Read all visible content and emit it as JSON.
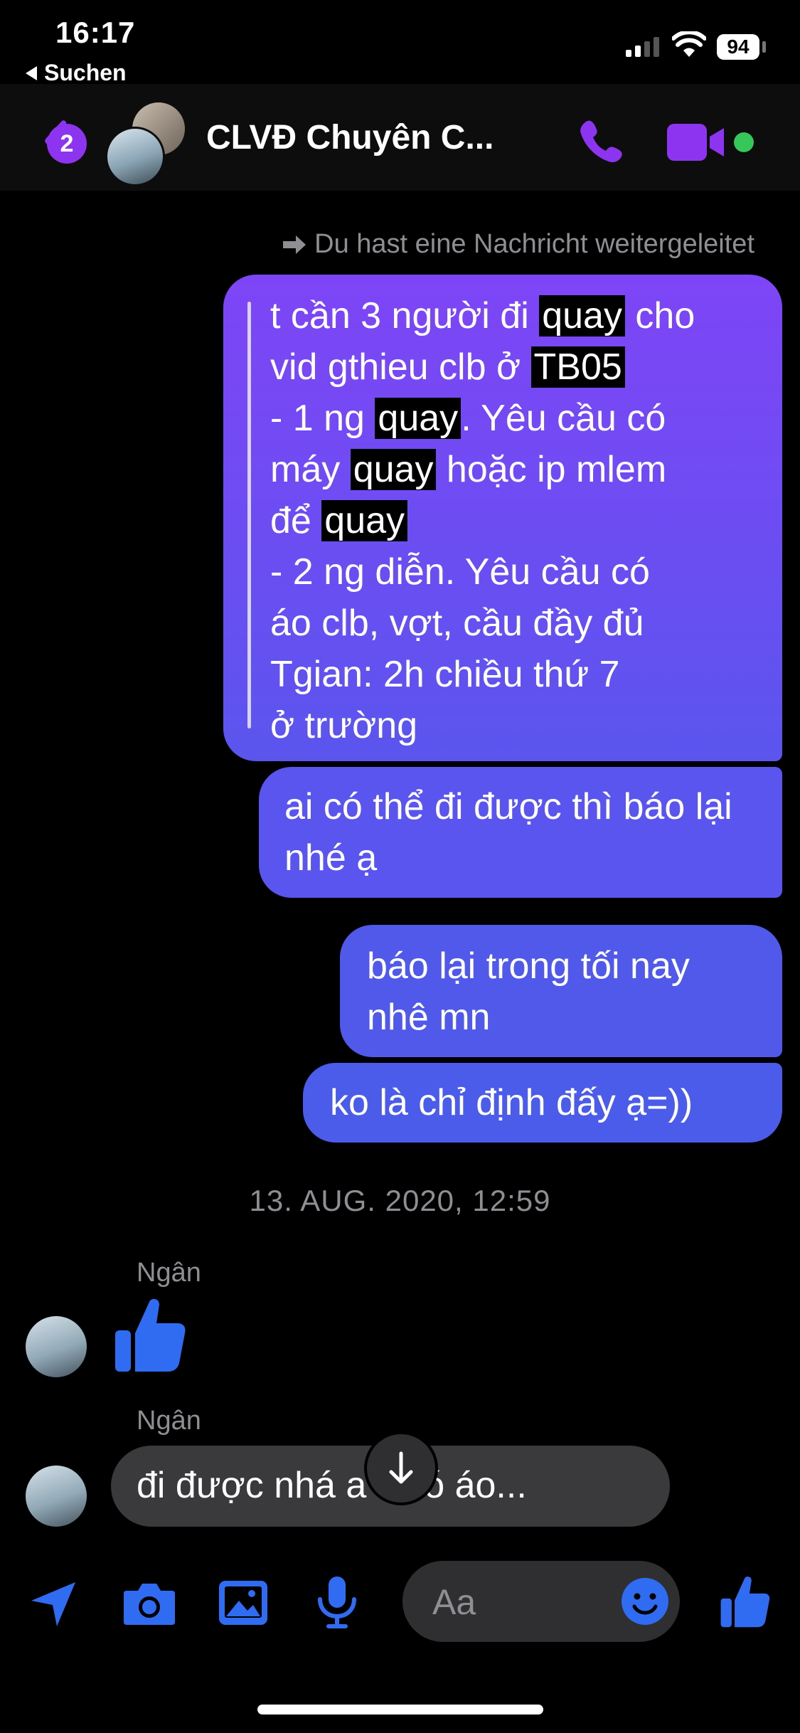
{
  "status": {
    "time": "16:17",
    "back_app": "Suchen",
    "battery": "94"
  },
  "header": {
    "badge": "2",
    "title": "CLVĐ Chuyên C..."
  },
  "chat": {
    "forward_note": "Du hast eine Nachricht weitergeleitet",
    "forwarded": {
      "lines": [
        [
          "t cần 3 người đi ",
          "quay",
          " cho"
        ],
        [
          "vid gthieu clb ở ",
          "TB05",
          ""
        ],
        [
          "- 1 ng ",
          "quay",
          ". Yêu cầu có"
        ],
        [
          "máy ",
          "quay",
          " hoặc ip mlem"
        ],
        [
          "để ",
          "quay",
          ""
        ],
        [
          "- 2 ng diễn. Yêu cầu có",
          "",
          ""
        ],
        [
          "áo clb, vợt, cầu đầy đủ",
          "",
          ""
        ],
        [
          "Tgian: 2h chiều thứ 7",
          "",
          ""
        ],
        [
          "ở trường",
          "",
          ""
        ]
      ]
    },
    "messages": [
      {
        "text": "ai có thể đi được thì báo lại nhé ạ"
      },
      {
        "text": "báo lại trong tối nay nhê mn"
      },
      {
        "text": "ko là chỉ định đấy ạ=))"
      }
    ],
    "timestamp": "13. AUG. 2020, 12:59",
    "incoming": [
      {
        "sender": "Ngân",
        "type": "like"
      },
      {
        "sender": "Ngân",
        "text": "đi được nhá      a k có áo..."
      }
    ]
  },
  "composer": {
    "placeholder": "Aa"
  },
  "colors": {
    "accent": "#8d34f0",
    "bubble_top": "#7e45f6",
    "bubble_bottom": "#4b5cea",
    "incoming_bubble": "#3a3a3c",
    "like_blue": "#2f6cf2",
    "online": "#35c759"
  },
  "icons": [
    "back-chevron-icon",
    "phone-icon",
    "video-icon",
    "forward-arrow-icon",
    "thumbs-up-icon",
    "arrow-down-icon",
    "send-location-icon",
    "camera-icon",
    "gallery-icon",
    "microphone-icon",
    "emoji-icon"
  ]
}
